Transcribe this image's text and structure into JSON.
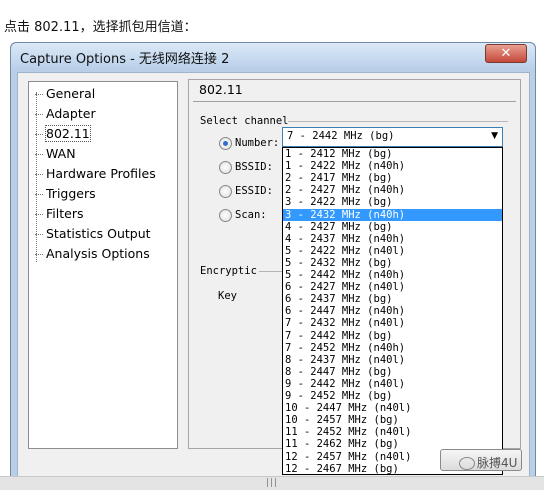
{
  "caption": "点击 802.11，选择抓包用信道：",
  "window": {
    "title": "Capture Options - 无线网络连接 2",
    "close_label": "✕"
  },
  "tree": {
    "items": [
      "General",
      "Adapter",
      "802.11",
      "WAN",
      "Hardware Profiles",
      "Triggers",
      "Filters",
      "Statistics Output",
      "Analysis Options"
    ],
    "selected": "802.11"
  },
  "pane": {
    "title": "802.11",
    "group_label": "Select channel",
    "radios": [
      {
        "label": "Number:",
        "selected": true
      },
      {
        "label": "BSSID:",
        "selected": false
      },
      {
        "label": "ESSID:",
        "selected": false
      },
      {
        "label": "Scan:",
        "selected": false
      }
    ],
    "select_value": "7 - 2442 MHz (bg)",
    "encryption_label": "Encryptic",
    "key_label": "Key"
  },
  "dropdown": {
    "options": [
      "1 - 2412 MHz (bg)",
      "1 - 2422 MHz (n40h)",
      "2 - 2417 MHz (bg)",
      "2 - 2427 MHz (n40h)",
      "3 - 2422 MHz (bg)",
      "3 - 2432 MHz (n40h)",
      "4 - 2427 MHz (bg)",
      "4 - 2437 MHz (n40h)",
      "5 - 2422 MHz (n40l)",
      "5 - 2432 MHz (bg)",
      "5 - 2442 MHz (n40h)",
      "6 - 2427 MHz (n40l)",
      "6 - 2437 MHz (bg)",
      "6 - 2447 MHz (n40h)",
      "7 - 2432 MHz (n40l)",
      "7 - 2442 MHz (bg)",
      "7 - 2452 MHz (n40h)",
      "8 - 2437 MHz (n40l)",
      "8 - 2447 MHz (bg)",
      "9 - 2442 MHz (n40l)",
      "9 - 2452 MHz (bg)",
      "10 - 2447 MHz (n40l)",
      "10 - 2457 MHz (bg)",
      "11 - 2452 MHz (n40l)",
      "11 - 2462 MHz (bg)",
      "12 - 2457 MHz (n40l)",
      "12 - 2467 MHz (bg)"
    ],
    "highlighted": "3 - 2432 MHz (n40h)"
  },
  "statusbar": {
    "grip": "|||"
  },
  "watermark": "脉搏4U",
  "colors": {
    "highlight": "#3399ff",
    "titlebar": "#c6daf0",
    "close": "#c4483a"
  }
}
